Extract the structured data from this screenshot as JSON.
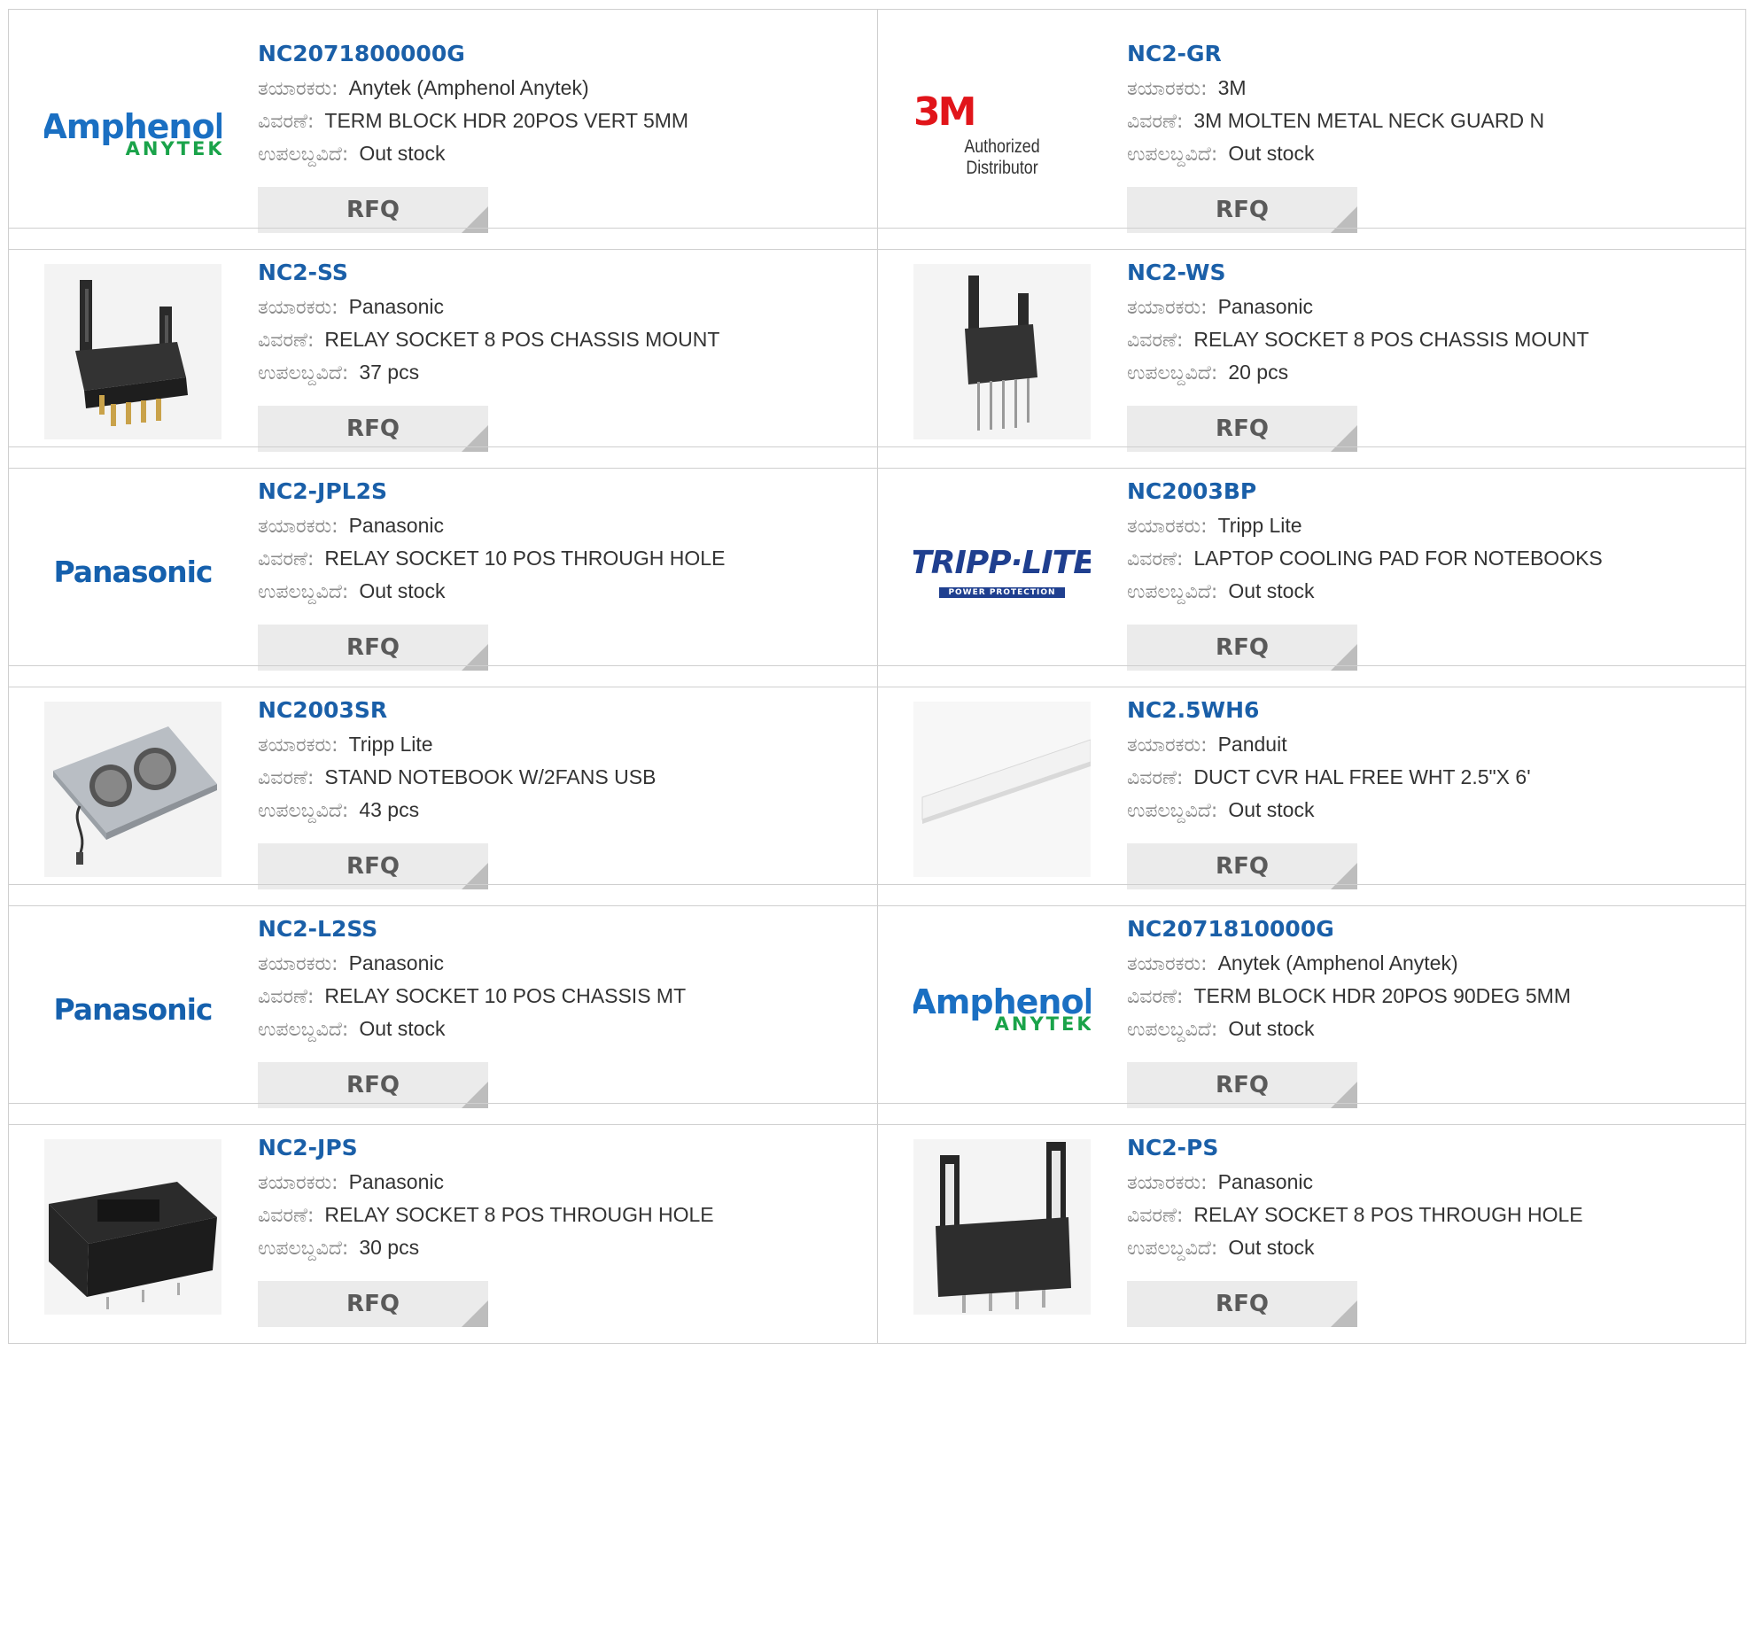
{
  "labels": {
    "manufacturer": "ತಯಾರಕರು:",
    "description": "ವಿವರಣೆ:",
    "availability": "ಉಪಲಬ್ದವಿದೆ:",
    "rfq": "RFQ"
  },
  "colors": {
    "part_number": "#1a5fa8",
    "border": "#cfcfcf",
    "rfq_bg": "#ebebeb"
  },
  "products": [
    {
      "part": "NC2071800000G",
      "manufacturer": "Anytek (Amphenol Anytek)",
      "description": "TERM BLOCK HDR 20POS VERT 5MM",
      "availability": "Out stock",
      "image": {
        "kind": "amphenol-logo",
        "line1": "Amphenol",
        "line2": "ANYTEK"
      }
    },
    {
      "part": "NC2-GR",
      "manufacturer": "3M",
      "description": "3M MOLTEN METAL NECK GUARD N",
      "availability": "Out stock",
      "image": {
        "kind": "3m-logo",
        "line1": "3M",
        "line2": "Authorized Distributor"
      }
    },
    {
      "part": "NC2-SS",
      "manufacturer": "Panasonic",
      "description": "RELAY SOCKET 8 POS CHASSIS MOUNT",
      "availability": "37 pcs",
      "image": {
        "kind": "relay-socket-photo"
      }
    },
    {
      "part": "NC2-WS",
      "manufacturer": "Panasonic",
      "description": "RELAY SOCKET 8 POS CHASSIS MOUNT",
      "availability": "20 pcs",
      "image": {
        "kind": "relay-socket-long-pins-photo"
      }
    },
    {
      "part": "NC2-JPL2S",
      "manufacturer": "Panasonic",
      "description": "RELAY SOCKET 10 POS THROUGH HOLE",
      "availability": "Out stock",
      "image": {
        "kind": "panasonic-logo",
        "line1": "Panasonic"
      }
    },
    {
      "part": "NC2003BP",
      "manufacturer": "Tripp Lite",
      "description": "LAPTOP COOLING PAD FOR NOTEBOOKS",
      "availability": "Out stock",
      "image": {
        "kind": "tripplite-logo",
        "line1": "TRIPP·LITE",
        "line2": "POWER PROTECTION"
      }
    },
    {
      "part": "NC2003SR",
      "manufacturer": "Tripp Lite",
      "description": "STAND NOTEBOOK W/2FANS USB",
      "availability": "43 pcs",
      "image": {
        "kind": "cooling-pad-photo"
      }
    },
    {
      "part": "NC2.5WH6",
      "manufacturer": "Panduit",
      "description": "DUCT CVR HAL FREE WHT 2.5\"X 6'",
      "availability": "Out stock",
      "image": {
        "kind": "duct-cover-photo"
      }
    },
    {
      "part": "NC2-L2SS",
      "manufacturer": "Panasonic",
      "description": "RELAY SOCKET 10 POS CHASSIS MT",
      "availability": "Out stock",
      "image": {
        "kind": "panasonic-logo",
        "line1": "Panasonic"
      }
    },
    {
      "part": "NC2071810000G",
      "manufacturer": "Anytek (Amphenol Anytek)",
      "description": "TERM BLOCK HDR 20POS 90DEG 5MM",
      "availability": "Out stock",
      "image": {
        "kind": "amphenol-logo",
        "line1": "Amphenol",
        "line2": "ANYTEK"
      }
    },
    {
      "part": "NC2-JPS",
      "manufacturer": "Panasonic",
      "description": "RELAY SOCKET 8 POS THROUGH HOLE",
      "availability": "30 pcs",
      "image": {
        "kind": "relay-socket-wide-photo"
      }
    },
    {
      "part": "NC2-PS",
      "manufacturer": "Panasonic",
      "description": "RELAY SOCKET 8 POS THROUGH HOLE",
      "availability": "Out stock",
      "image": {
        "kind": "relay-socket-tall-photo"
      }
    }
  ]
}
